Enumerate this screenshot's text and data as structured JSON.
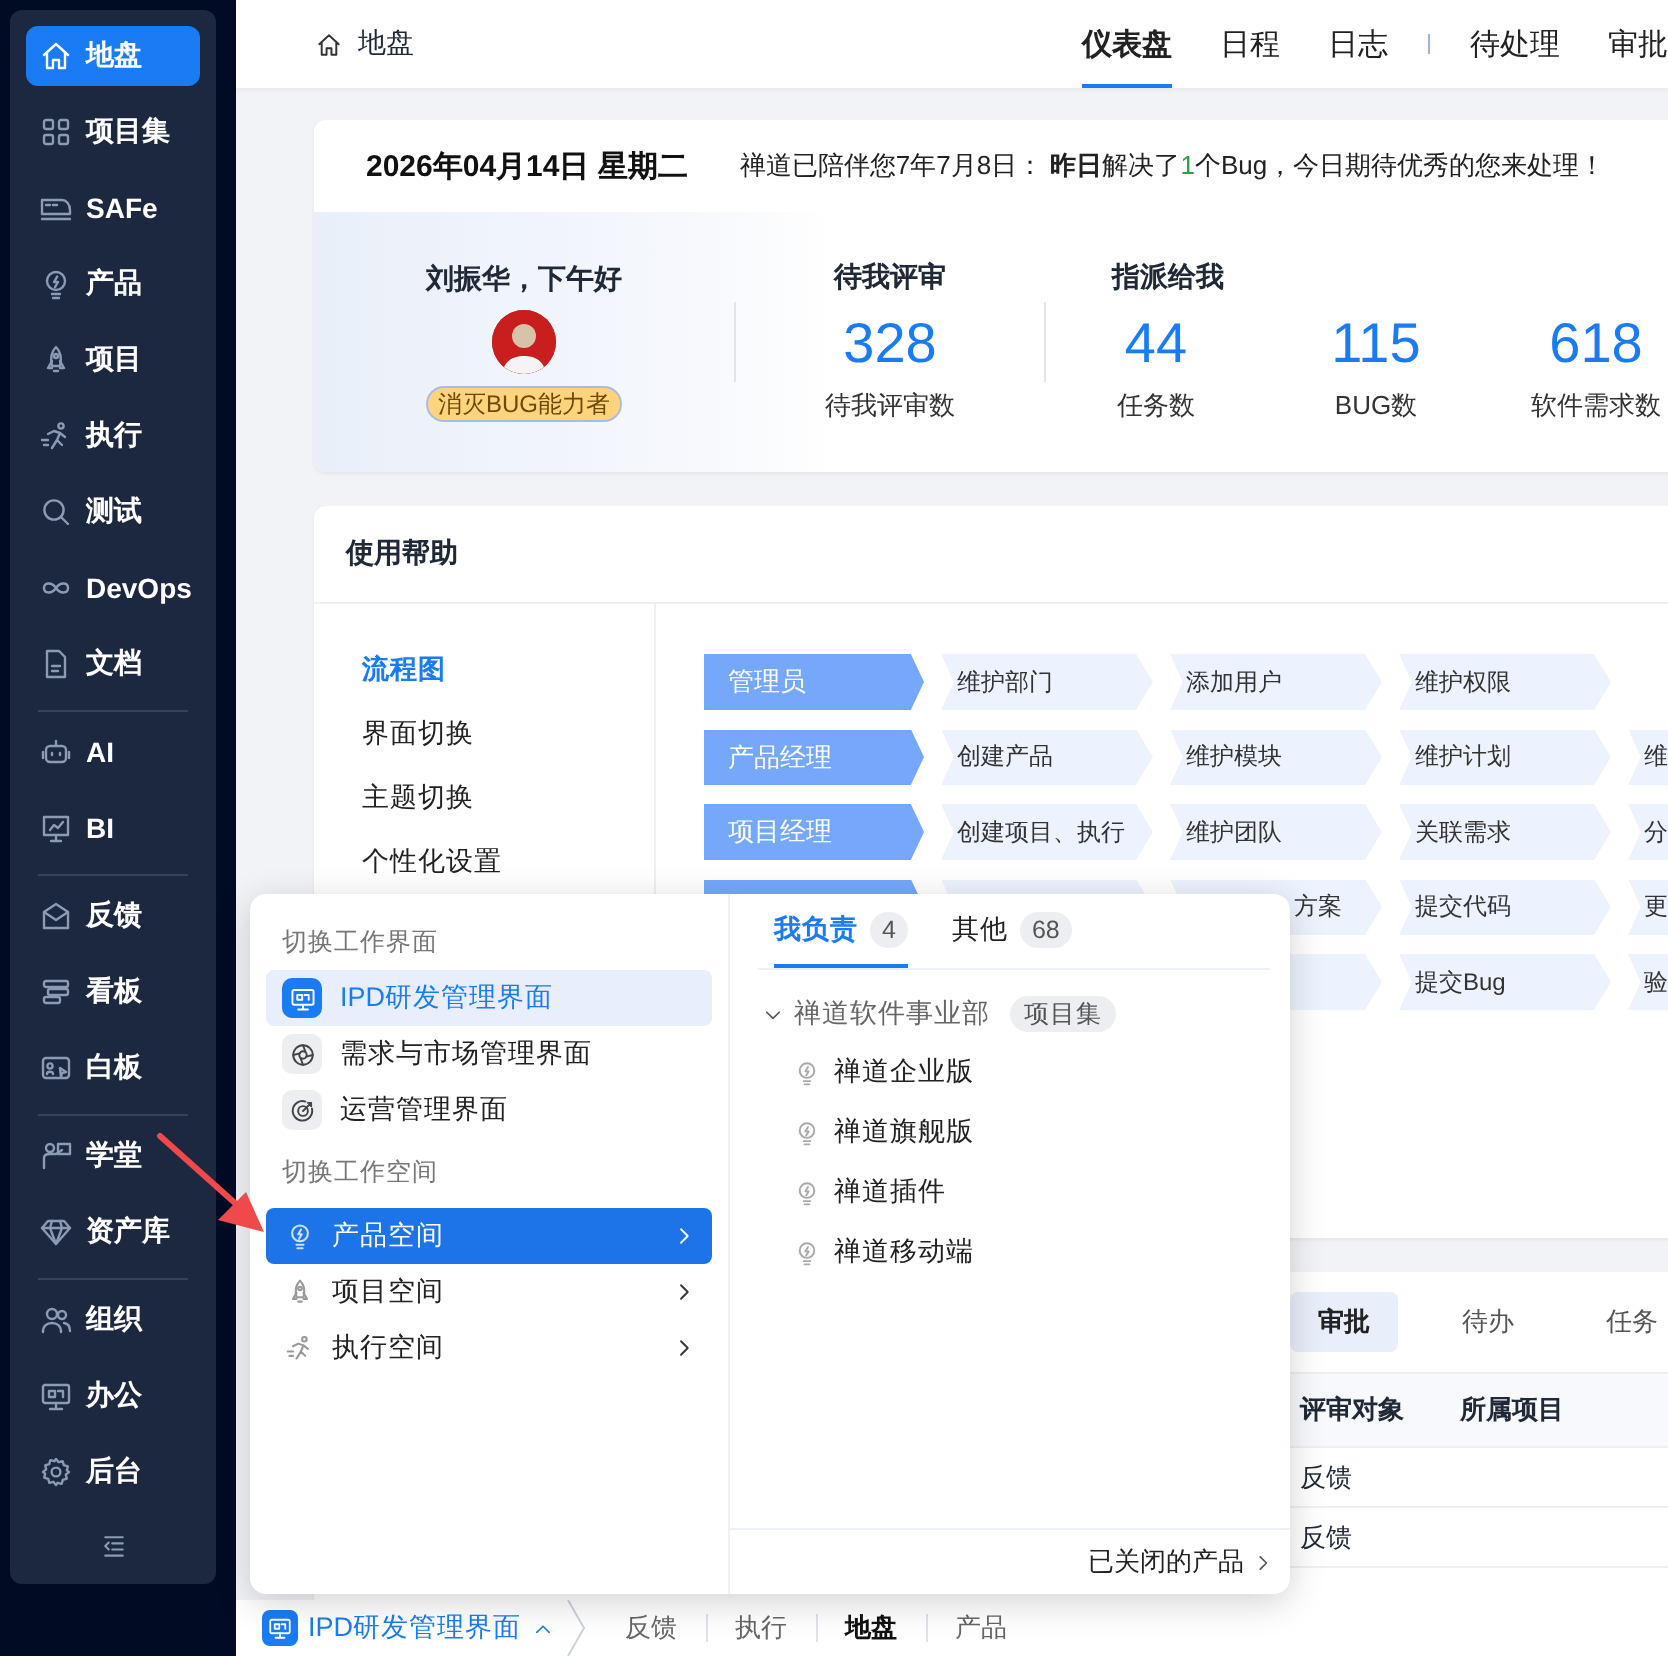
{
  "sidebar": {
    "groups": [
      {
        "items": [
          {
            "label": "地盘",
            "selected": true
          },
          {
            "label": "项目集",
            "selected": false
          },
          {
            "label": "SAFe",
            "selected": false
          },
          {
            "label": "产品",
            "selected": false
          },
          {
            "label": "项目",
            "selected": false
          },
          {
            "label": "执行",
            "selected": false
          },
          {
            "label": "测试",
            "selected": false
          },
          {
            "label": "DevOps",
            "selected": false
          },
          {
            "label": "文档",
            "selected": false
          }
        ]
      },
      {
        "items": [
          {
            "label": "AI",
            "selected": false
          },
          {
            "label": "BI",
            "selected": false
          }
        ]
      },
      {
        "items": [
          {
            "label": "反馈",
            "selected": false
          },
          {
            "label": "看板",
            "selected": false
          },
          {
            "label": "白板",
            "selected": false
          }
        ]
      },
      {
        "items": [
          {
            "label": "学堂",
            "selected": false
          },
          {
            "label": "资产库",
            "selected": false
          }
        ]
      },
      {
        "items": [
          {
            "label": "组织",
            "selected": false
          },
          {
            "label": "办公",
            "selected": false
          },
          {
            "label": "后台",
            "selected": false
          }
        ]
      }
    ]
  },
  "header": {
    "breadcrumb": "地盘",
    "tab_groups": [
      {
        "tabs": [
          {
            "label": "仪表盘",
            "selected": true
          },
          {
            "label": "日程",
            "selected": false
          },
          {
            "label": "日志",
            "selected": false
          }
        ]
      },
      {
        "tabs": [
          {
            "label": "待处理",
            "selected": false
          },
          {
            "label": "审批",
            "selected": false
          }
        ]
      }
    ]
  },
  "welcome": {
    "date": "2026年04月14日 星期二",
    "message": {
      "before": "禅道已陪伴您7年7月8日： **昨日**解决了",
      "count": "1",
      "after": "个Bug，今日期待优秀的您来处理！"
    },
    "greeting": "刘振华，下午好",
    "badge": "消灭BUG能力者",
    "stat_groups": [
      {
        "title": "待我评审",
        "stats": [
          {
            "value": "328",
            "label": "待我评审数"
          }
        ]
      },
      {
        "title": "指派给我",
        "stats": [
          {
            "value": "44",
            "label": "任务数"
          },
          {
            "value": "115",
            "label": "BUG数"
          },
          {
            "value": "618",
            "label": "软件需求数"
          }
        ]
      }
    ]
  },
  "help": {
    "title": "使用帮助",
    "menu": [
      {
        "label": "流程图",
        "selected": true
      },
      {
        "label": "界面切换",
        "selected": false
      },
      {
        "label": "主题切换",
        "selected": false
      },
      {
        "label": "个性化设置",
        "selected": false
      }
    ],
    "flow_rows": [
      {
        "kind": "full",
        "role": "管理员",
        "steps": [
          {
            "kind": "step",
            "label": "维护部门"
          },
          {
            "kind": "step",
            "label": "添加用户"
          },
          {
            "kind": "step",
            "label": "维护权限"
          }
        ]
      },
      {
        "kind": "full",
        "role": "产品经理",
        "steps": [
          {
            "kind": "step",
            "label": "创建产品"
          },
          {
            "kind": "step",
            "label": "维护模块"
          },
          {
            "kind": "step",
            "label": "维护计划"
          },
          {
            "kind": "step",
            "label": "维"
          }
        ]
      },
      {
        "kind": "full",
        "role": "项目经理",
        "steps": [
          {
            "kind": "step",
            "label": "创建项目、执行"
          },
          {
            "kind": "step",
            "label": "维护团队"
          },
          {
            "kind": "step",
            "label": "关联需求"
          },
          {
            "kind": "step",
            "label": "分"
          }
        ]
      },
      {
        "kind": "covered_role",
        "steps": [
          {
            "kind": "covered"
          },
          {
            "kind": "partial",
            "label": "方案"
          },
          {
            "kind": "step",
            "label": "提交代码"
          },
          {
            "kind": "step",
            "label": "更"
          }
        ]
      },
      {
        "kind": "covered_start",
        "steps": [
          {
            "kind": "covered"
          },
          {
            "kind": "step",
            "label": "提交Bug"
          },
          {
            "kind": "step",
            "label": "验"
          }
        ]
      }
    ]
  },
  "approvals": {
    "tabs": [
      {
        "label": "审批",
        "selected": true
      },
      {
        "label": "待办",
        "selected": false
      },
      {
        "label": "任务",
        "selected": false
      }
    ],
    "columns": [
      "评审对象",
      "所属项目"
    ],
    "rows": [
      {
        "cells": [
          "反馈"
        ]
      },
      {
        "cells": [
          "反馈"
        ]
      }
    ]
  },
  "switcher_popup": {
    "interface_heading": "切换工作界面",
    "interfaces": [
      {
        "label": "IPD研发管理界面",
        "selected": true
      },
      {
        "label": "需求与市场管理界面",
        "selected": false
      },
      {
        "label": "运营管理界面",
        "selected": false
      }
    ],
    "space_heading": "切换工作空间",
    "spaces": [
      {
        "label": "产品空间",
        "selected": true
      },
      {
        "label": "项目空间",
        "selected": false
      },
      {
        "label": "执行空间",
        "selected": false
      }
    ],
    "tabs": [
      {
        "label": "我负责",
        "count": "4",
        "selected": true
      },
      {
        "label": "其他",
        "count": "68",
        "selected": false
      }
    ],
    "tree": [
      {
        "label": "禅道软件事业部",
        "tag": "项目集",
        "expanded": true,
        "children": [
          {
            "label": "禅道企业版"
          },
          {
            "label": "禅道旗舰版"
          },
          {
            "label": "禅道插件"
          },
          {
            "label": "禅道移动端"
          }
        ]
      }
    ],
    "footer_link": "已关闭的产品"
  },
  "bottom_bar": {
    "interface": "IPD研发管理界面",
    "crumbs": [
      {
        "label": "反馈",
        "selected": false
      },
      {
        "label": "执行",
        "selected": false
      },
      {
        "label": "地盘",
        "selected": true
      },
      {
        "label": "产品",
        "selected": false
      }
    ]
  }
}
